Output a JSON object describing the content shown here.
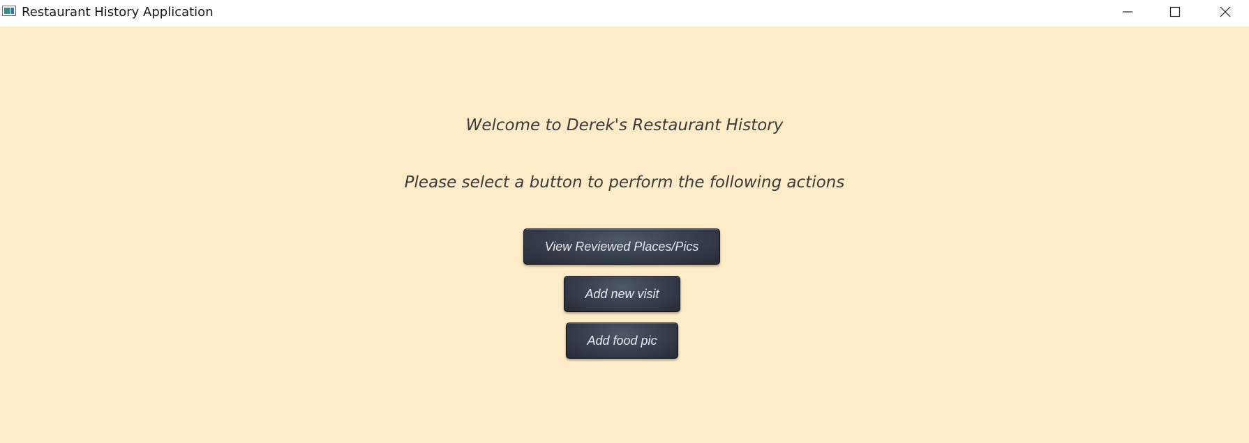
{
  "window": {
    "title": "Restaurant History Application",
    "controls": {
      "minimize": "minimize-icon",
      "maximize": "maximize-icon",
      "close": "close-icon"
    }
  },
  "main": {
    "welcome_text": "Welcome to Derek's Restaurant History",
    "instruction_text": "Please select a button to perform the following actions",
    "buttons": {
      "view_reviewed": "View Reviewed Places/Pics",
      "add_visit": "Add new visit",
      "add_food_pic": "Add food pic"
    }
  },
  "colors": {
    "background": "#feebc8",
    "button": "#3a414f",
    "button_text": "#e6e8ec",
    "heading_text": "#3b3b3b"
  }
}
